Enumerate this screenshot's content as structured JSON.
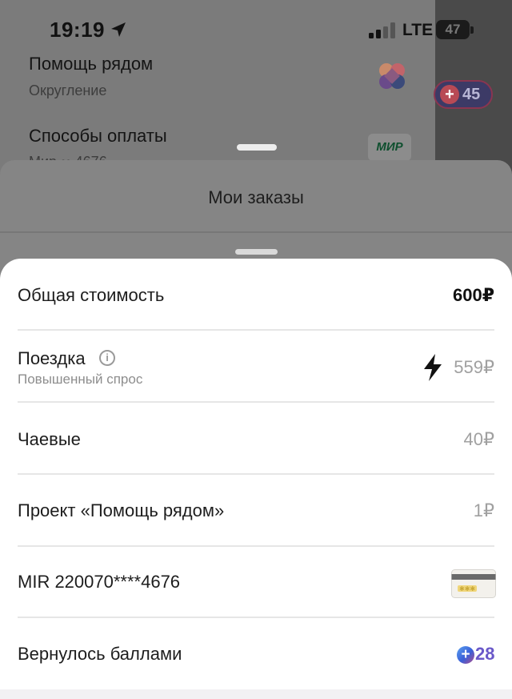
{
  "status_bar": {
    "time": "19:19",
    "network": "LTE",
    "battery": "47"
  },
  "background": {
    "items": [
      {
        "title": "Помощь рядом",
        "subtitle": "Округление"
      },
      {
        "title": "Способы оплаты",
        "subtitle": "Мир •• 4676"
      }
    ],
    "mir_badge": "МИР",
    "points_pill": "45"
  },
  "mid_sheet": {
    "title": "Мои заказы"
  },
  "breakdown": {
    "total": {
      "label": "Общая стоимость",
      "value": "600₽"
    },
    "ride": {
      "label": "Поездка",
      "subtitle": "Повышенный спрос",
      "value": "559₽"
    },
    "tips": {
      "label": "Чаевые",
      "value": "40₽"
    },
    "charity": {
      "label": "Проект «Помощь рядом»",
      "value": "1₽"
    },
    "card": {
      "label": "MIR 220070****4676"
    },
    "points": {
      "label": "Вернулось баллами",
      "value": "28"
    }
  },
  "colors": {
    "points_accent": "#6a58c9",
    "surge_icon": "#111111"
  },
  "icons": [
    "location-arrow-icon",
    "signal-icon",
    "help-nearby-logo-icon",
    "info-icon",
    "lightning-icon",
    "bank-card-icon",
    "plus-points-icon"
  ]
}
